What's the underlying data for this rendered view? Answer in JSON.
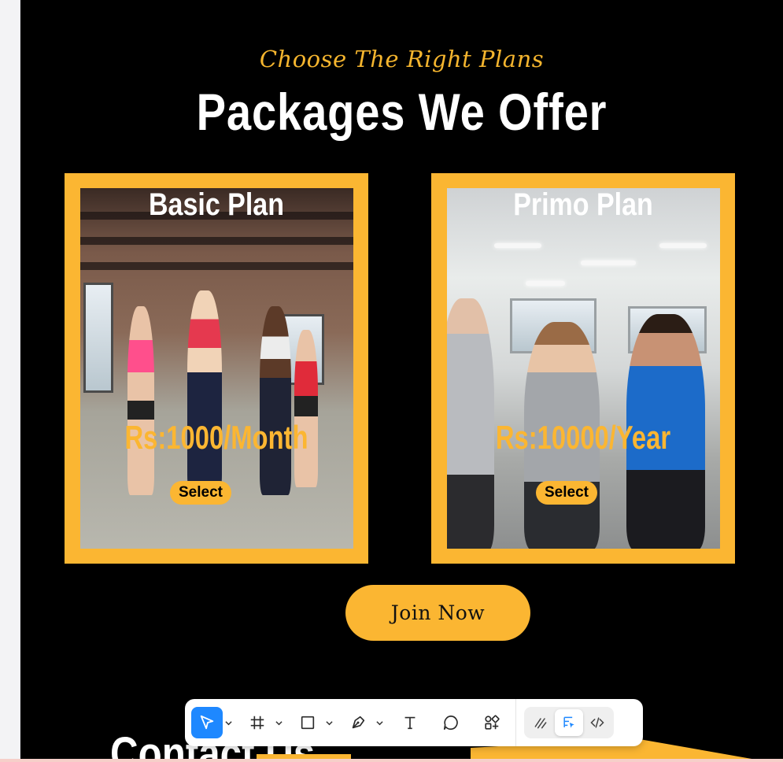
{
  "section": {
    "tagline": "Choose The Right Plans",
    "heading": "Packages We Offer"
  },
  "plans": [
    {
      "title": "Basic Plan",
      "price": "Rs:1000/Month",
      "select_label": "Select"
    },
    {
      "title": "Primo Plan",
      "price": "Rs:10000/Year",
      "select_label": "Select"
    }
  ],
  "join_label": "Join Now",
  "contact_heading": "Contact Us",
  "colors": {
    "accent": "#fbb632",
    "background": "#000000",
    "toolbar_active": "#1e88ff"
  },
  "toolbar": {
    "tools": [
      {
        "icon": "move-icon",
        "active": true
      },
      {
        "icon": "frame-icon"
      },
      {
        "icon": "rectangle-icon"
      },
      {
        "icon": "pen-icon"
      },
      {
        "icon": "text-icon"
      },
      {
        "icon": "comment-icon"
      },
      {
        "icon": "components-icon"
      }
    ],
    "modes": [
      {
        "icon": "draw-icon"
      },
      {
        "icon": "design-mode-icon",
        "active": true
      },
      {
        "icon": "dev-mode-icon"
      }
    ]
  }
}
